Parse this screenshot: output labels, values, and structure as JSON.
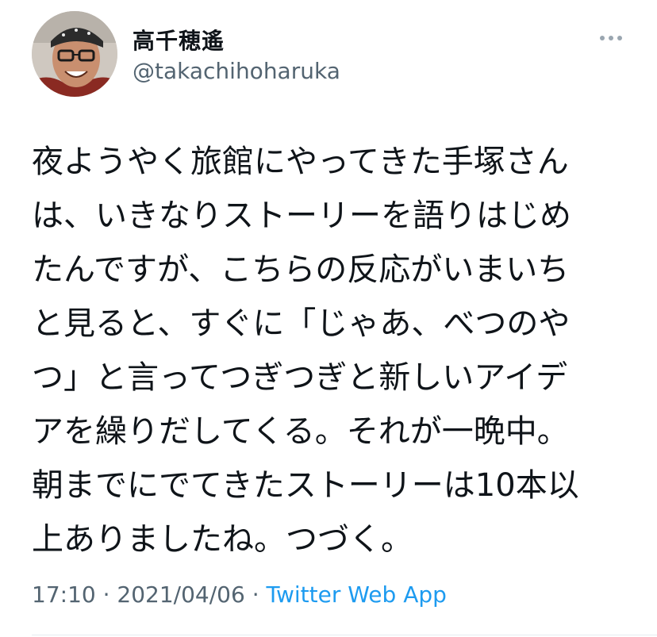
{
  "author": {
    "display_name": "高千穂遙",
    "handle": "@takachihoharuka",
    "avatar_icon": "avatar-photo"
  },
  "more_icon": "ellipsis-icon",
  "tweet": {
    "lines": [
      "夜ようやく旅館にやってきた手塚さん",
      "は、いきなりストーリーを語りはじめ",
      "たんですが、こちらの反応がいまいち",
      "と見ると、すぐに「じゃあ、べつのや",
      "つ」と言ってつぎつぎと新しいアイデ",
      "アを繰りだしてくる。それが一晩中。",
      "朝までにでてきたストーリーは10本以",
      "上ありましたね。つづく。"
    ]
  },
  "meta": {
    "time": "17:10",
    "separator1": " · ",
    "date": "2021/04/06",
    "separator2": " · ",
    "source": "Twitter Web App"
  },
  "colors": {
    "text": "#0f1419",
    "secondary": "#536471",
    "link": "#1d9bf0"
  }
}
